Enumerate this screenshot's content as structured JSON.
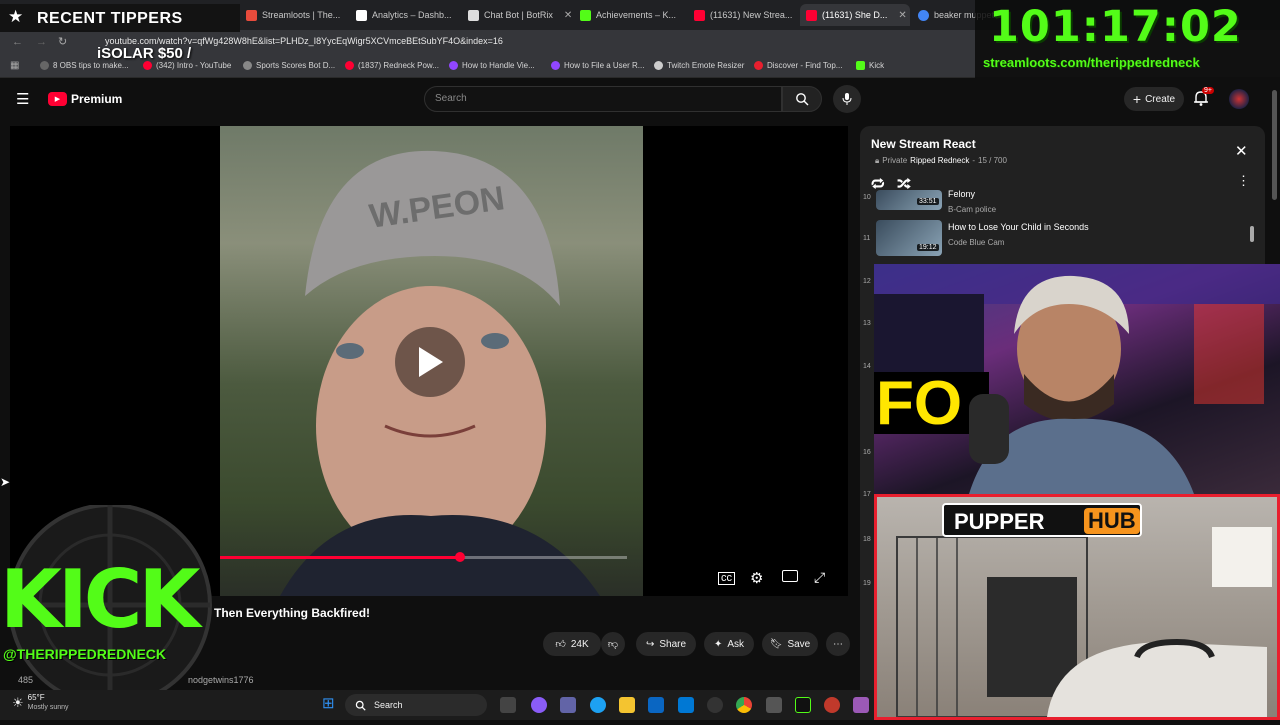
{
  "browser": {
    "tabs": [
      {
        "label": "Streamloots | The...",
        "color": "#ffffff"
      },
      {
        "label": "Analytics – Dashb...",
        "color": "#ffffff"
      },
      {
        "label": "Chat Bot | BotRix",
        "color": "#ffffff"
      },
      {
        "label": "Achievements – K...",
        "color": "#53fc18"
      },
      {
        "label": "(11631) New Strea...",
        "color": "#ff0033"
      },
      {
        "label": "(11631) She D...",
        "color": "#ff0033"
      },
      {
        "label": "beaker muppets",
        "color": "#4285f4"
      }
    ],
    "url": "youtube.com/watch?v=qfWg428W8hE&list=PLHDz_I8YycEqWigr5XCVmceBEtSubYF4O&index=16",
    "bookmarks": [
      "8 OBS tips to make...",
      "(342) Intro - YouTube",
      "Sports Scores Bot D...",
      "(1837) Redneck Pow...",
      "How to Handle Vie...",
      "How to File a User R...",
      "Twitch Emote Resizer",
      "Discover - Find Top...",
      "Kick"
    ]
  },
  "youtube": {
    "logo_text": "Premium",
    "search_placeholder": "Search",
    "create_label": "Create",
    "notification_badge": "9+",
    "video": {
      "title_visible": "Then Everything Backfired!",
      "progress_fraction": 0.59,
      "likes": "24K",
      "share_label": "Share",
      "ask_label": "Ask",
      "save_label": "Save",
      "channel_partial": "nodgetwins1776",
      "count_partial": "485"
    },
    "playlist": {
      "title": "New Stream React",
      "privacy": "Private",
      "owner": "Ripped Redneck",
      "position": "15 / 700",
      "items": [
        {
          "title": "Felony",
          "channel": "B-Cam police",
          "duration": "33:51",
          "index": "10"
        },
        {
          "title": "How to Lose Your Child in Seconds",
          "channel": "Code Blue Cam",
          "duration": "19:12",
          "index": "11"
        }
      ],
      "side_indices": [
        "12",
        "13",
        "14",
        "16",
        "17",
        "18",
        "19"
      ]
    }
  },
  "overlays": {
    "recent_tippers": "RECENT TIPPERS",
    "tipper_entry": "iSOLAR $50 /",
    "timer": "101:17:02",
    "streamloots_url": "streamloots.com/therippedredneck",
    "kick_text": "KICK",
    "kick_handle": "@THERIPPEDREDNECK",
    "pupper_hub_left": "PUPPER",
    "pupper_hub_right": "HUB"
  },
  "taskbar": {
    "weather_temp": "65°F",
    "weather_desc": "Mostly sunny",
    "search_label": "Search"
  },
  "colors": {
    "yt_red": "#ff0033",
    "kick_green": "#53fc18",
    "pupper_red": "#e81f2e"
  }
}
